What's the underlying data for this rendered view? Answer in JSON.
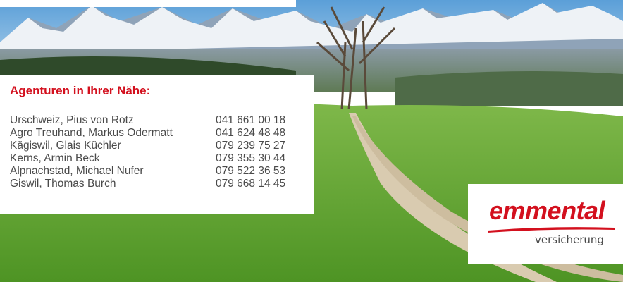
{
  "agencies": {
    "title": "Agenturen in Ihrer Nähe:",
    "items": [
      {
        "name": "Urschweiz, Pius von Rotz",
        "phone": "041 661 00 18"
      },
      {
        "name": "Agro Treuhand, Markus Odermatt",
        "phone": "041 624 48 48"
      },
      {
        "name": "Kägiswil, Glais Küchler",
        "phone": "079 239 75 27"
      },
      {
        "name": "Kerns, Armin Beck",
        "phone": "079 355 30 44"
      },
      {
        "name": "Alpnachstad, Michael Nufer",
        "phone": "079 522 36 53"
      },
      {
        "name": "Giswil, Thomas Burch",
        "phone": "079 668 14 45"
      }
    ]
  },
  "logo": {
    "brand": "emmental",
    "sub": "versicherung",
    "color": "#d3101e"
  },
  "colors": {
    "accent": "#d3101e",
    "text": "#4a4a4a",
    "card": "#ffffff"
  }
}
